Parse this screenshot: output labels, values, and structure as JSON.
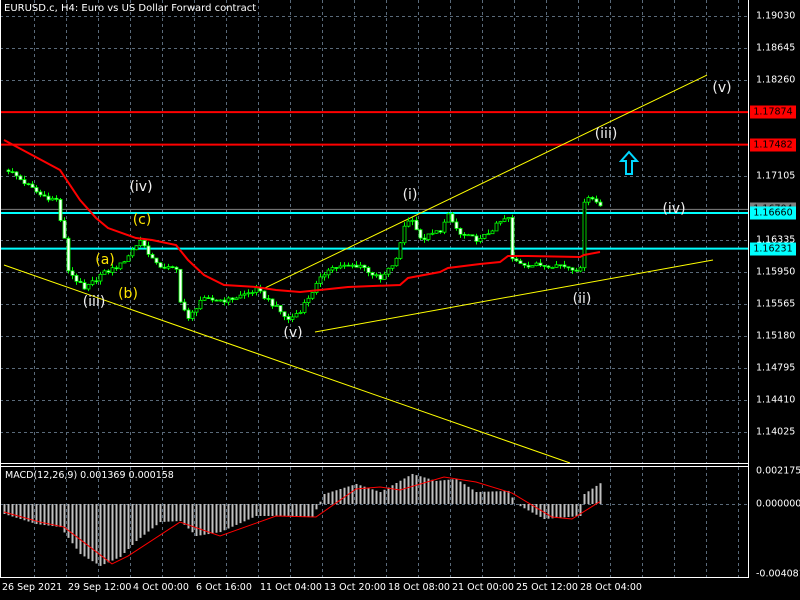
{
  "header": {
    "title": "EURUSD.c, H4:  Euro vs US Dollar Forward contract"
  },
  "colors": {
    "bull": "#00ff00",
    "ma": "#ff0000",
    "resistance": "#ff0000",
    "support": "#00ffff",
    "trendline": "#ffff00",
    "macd_hist": "#c0c0c0",
    "macd_signal": "#ff0000",
    "grid": "#5a6a7a"
  },
  "price_axis": {
    "ticks": [
      "1.19030",
      "1.18645",
      "1.18260",
      "1.17105",
      "1.16335",
      "1.15950",
      "1.15565",
      "1.15180",
      "1.14795",
      "1.14410",
      "1.14025"
    ],
    "labels": [
      {
        "text": "1.17874",
        "bg": "#ff0000"
      },
      {
        "text": "1.17482",
        "bg": "#ff0000"
      },
      {
        "text": "1.16704",
        "bg": "#808080"
      },
      {
        "text": "1.16660",
        "bg": "#00ffff"
      },
      {
        "text": "1.16231",
        "bg": "#00ffff"
      }
    ]
  },
  "macd_axis": {
    "ticks": [
      "0.002175",
      "0.000000",
      "-0.004081"
    ]
  },
  "time_axis": {
    "labels": [
      "26 Sep 2021",
      "29 Sep 12:00",
      "4 Oct 00:00",
      "6 Oct 16:00",
      "11 Oct 04:00",
      "13 Oct 20:00",
      "18 Oct 08:00",
      "21 Oct 00:00",
      "25 Oct 12:00",
      "28 Oct 04:00"
    ]
  },
  "macd": {
    "label": "MACD(12,26,9) 0.001369 0.000158",
    "value": 0.001369,
    "signal_value": 0.000158
  },
  "waves": {
    "iv_old": "(iv)",
    "c": "(c)",
    "a": "(a)",
    "b": "(b)",
    "iii_old": "(iii)",
    "v_old": "(v)",
    "i": "(i)",
    "ii": "(ii)",
    "iii": "(iii)",
    "iv": "(iv)",
    "v": "(v)"
  },
  "chart_data": {
    "type": "candlestick",
    "symbol": "EURUSD.c",
    "timeframe": "H4",
    "ylim": [
      1.1385,
      1.192
    ],
    "horizontal_levels": {
      "resistance": [
        1.17874,
        1.17482
      ],
      "support": [
        1.1666,
        1.16231
      ],
      "current": 1.16704
    },
    "price_path": [
      [
        0,
        1.17177
      ],
      [
        8,
        1.16876
      ],
      [
        12,
        1.16816
      ],
      [
        14,
        1.16335
      ],
      [
        15,
        1.15974
      ],
      [
        19,
        1.15733
      ],
      [
        23,
        1.15914
      ],
      [
        28,
        1.16034
      ],
      [
        33,
        1.16335
      ],
      [
        37,
        1.16034
      ],
      [
        42,
        1.15974
      ],
      [
        43,
        1.15613
      ],
      [
        45,
        1.15373
      ],
      [
        48,
        1.15613
      ],
      [
        55,
        1.15613
      ],
      [
        62,
        1.15733
      ],
      [
        65,
        1.15613
      ],
      [
        70,
        1.15373
      ],
      [
        73,
        1.15493
      ],
      [
        77,
        1.15794
      ],
      [
        80,
        1.15998
      ],
      [
        88,
        1.16034
      ],
      [
        93,
        1.15854
      ],
      [
        97,
        1.16094
      ],
      [
        99,
        1.16515
      ],
      [
        101,
        1.166
      ],
      [
        103,
        1.16335
      ],
      [
        108,
        1.16455
      ],
      [
        110,
        1.16624
      ],
      [
        113,
        1.16395
      ],
      [
        118,
        1.16335
      ],
      [
        123,
        1.16552
      ],
      [
        125,
        1.166
      ],
      [
        126,
        1.16094
      ],
      [
        130,
        1.16034
      ],
      [
        138,
        1.16034
      ],
      [
        143,
        1.15974
      ],
      [
        144,
        1.16816
      ],
      [
        145,
        1.16864
      ],
      [
        148,
        1.16756
      ]
    ],
    "moving_average": [
      [
        -1,
        1.17538
      ],
      [
        6,
        1.17358
      ],
      [
        13,
        1.17177
      ],
      [
        18,
        1.16816
      ],
      [
        22,
        1.166
      ],
      [
        25,
        1.16479
      ],
      [
        32,
        1.16359
      ],
      [
        36,
        1.16335
      ],
      [
        42,
        1.16275
      ],
      [
        45,
        1.16094
      ],
      [
        49,
        1.15914
      ],
      [
        54,
        1.15794
      ],
      [
        62,
        1.1577
      ],
      [
        67,
        1.15733
      ],
      [
        73,
        1.15709
      ],
      [
        78,
        1.15733
      ],
      [
        85,
        1.1577
      ],
      [
        98,
        1.15794
      ],
      [
        100,
        1.15878
      ],
      [
        108,
        1.1595
      ],
      [
        110,
        1.15998
      ],
      [
        118,
        1.16046
      ],
      [
        123,
        1.1607
      ],
      [
        125,
        1.16143
      ],
      [
        130,
        1.16143
      ],
      [
        143,
        1.1613
      ],
      [
        144,
        1.16155
      ],
      [
        148,
        1.16191
      ]
    ],
    "trendlines": [
      [
        [
          -1,
          1.16034
        ],
        [
          140.5,
          1.13652
        ]
      ],
      [
        [
          64.25,
          1.15758
        ],
        [
          174.75,
          1.1832
        ]
      ],
      [
        [
          76.75,
          1.15228
        ],
        [
          176.25,
          1.16094
        ]
      ]
    ],
    "macd_histogram": [
      [
        -1,
        -0.00066
      ],
      [
        7,
        -0.00132
      ],
      [
        13,
        -0.00152
      ],
      [
        18,
        -0.0033
      ],
      [
        23,
        -0.00408
      ],
      [
        28,
        -0.00349
      ],
      [
        32,
        -0.00244
      ],
      [
        38,
        -0.00119
      ],
      [
        43,
        -0.00112
      ],
      [
        47,
        -0.00211
      ],
      [
        53,
        -0.00185
      ],
      [
        62,
        -0.00079
      ],
      [
        71,
        -0.00079
      ],
      [
        76,
        -0.00086
      ],
      [
        79,
        0.00066
      ],
      [
        87,
        0.00132
      ],
      [
        93,
        0.00079
      ],
      [
        101,
        0.00198
      ],
      [
        107,
        0.00152
      ],
      [
        112,
        0.00165
      ],
      [
        117,
        0.00079
      ],
      [
        125,
        0.00086
      ],
      [
        127,
        0
      ],
      [
        134,
        -0.00099
      ],
      [
        143,
        -0.00079
      ],
      [
        144,
        0.00066
      ],
      [
        148,
        0.00137
      ]
    ],
    "macd_signal": [
      [
        -1,
        -0.00053
      ],
      [
        8,
        -0.00119
      ],
      [
        14,
        -0.00152
      ],
      [
        26,
        -0.00395
      ],
      [
        30,
        -0.00343
      ],
      [
        43,
        -0.00119
      ],
      [
        53,
        -0.00211
      ],
      [
        67,
        -0.00079
      ],
      [
        77,
        -0.00086
      ],
      [
        87,
        0.00099
      ],
      [
        93,
        0.00112
      ],
      [
        98,
        0.00092
      ],
      [
        109,
        0.00178
      ],
      [
        117,
        0.00145
      ],
      [
        126,
        0.00072
      ],
      [
        136,
        -0.00086
      ],
      [
        141,
        -0.00099
      ],
      [
        148,
        0.00016
      ]
    ],
    "macd_ylim": [
      -0.004081,
      0.002175
    ]
  }
}
